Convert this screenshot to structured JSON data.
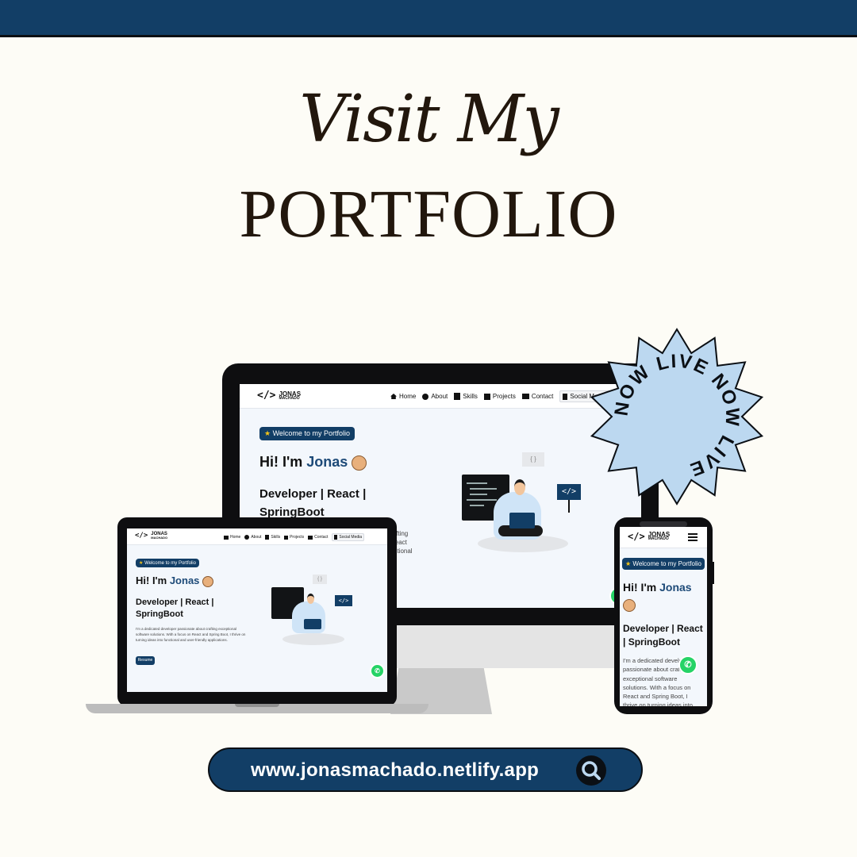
{
  "headline": {
    "script": "Visit My",
    "main": "PORTFOLIO"
  },
  "badge": {
    "text": "NOW LIVE NOW LIVE"
  },
  "site": {
    "logo_line1": "JONAS",
    "logo_line2": "MACHADO",
    "logo_mark": "</>",
    "nav": {
      "home": "Home",
      "about": "About",
      "skills": "Skills",
      "projects": "Projects",
      "contact": "Contact",
      "social": "Social Media"
    },
    "welcome": "Welcome to my Portfolio",
    "hi": "Hi! I'm",
    "name": "Jonas",
    "role": "Developer | React | SpringBoot",
    "description": "I'm a dedicated developer passionate about crafting exceptional software solutions. With a focus on React and Spring Boot, I thrive on turning ideas into functional and user-friendly applications.",
    "resume": "Resume",
    "code_tag": "</>",
    "braces": "{ }",
    "monitor_desc_fragment": "rafting\nReact\nnctional"
  },
  "phone": {
    "description": "I'm a dedicated developer passionate about crafting exceptional software solutions. With a focus on React and Spring Boot, I thrive on turning ideas into"
  },
  "url": {
    "text": "www.jonasmachado.netlify.app"
  },
  "colors": {
    "navy": "#123e66",
    "cream": "#fdfcf6",
    "badge": "#bcd8f0",
    "ink": "#22170d"
  }
}
